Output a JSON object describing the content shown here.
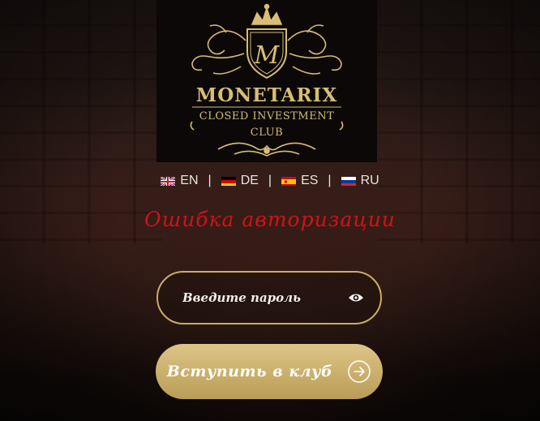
{
  "brand": {
    "name": "MONETARIX",
    "subtitle_line1": "CLOSED INVESTMENT",
    "subtitle_line2": "CLUB",
    "monogram": "M"
  },
  "languages": [
    {
      "code": "EN",
      "flag_icon": "uk-flag-icon"
    },
    {
      "code": "DE",
      "flag_icon": "germany-flag-icon"
    },
    {
      "code": "ES",
      "flag_icon": "spain-flag-icon"
    },
    {
      "code": "RU",
      "flag_icon": "russia-flag-icon"
    }
  ],
  "separator": "|",
  "error": {
    "title": "Ошибка авторизации"
  },
  "password": {
    "placeholder": "Введите пароль",
    "value": "",
    "toggle_icon": "eye-icon"
  },
  "submit": {
    "label": "Вступить в клуб",
    "icon": "arrow-right-circle-icon"
  },
  "colors": {
    "gold": "#d9bd74",
    "error_red": "#d0121a",
    "button_gold": "#caaf6c"
  }
}
